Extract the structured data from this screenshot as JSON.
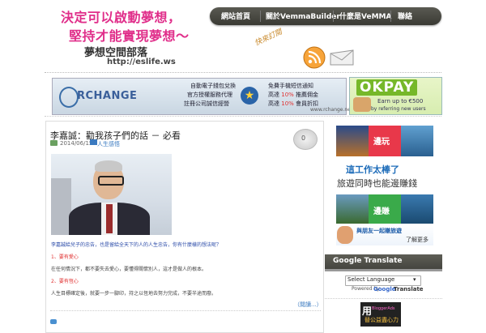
{
  "header": {
    "slogan_line1": "決定可以啟動夢想，",
    "slogan_line2": "堅持才能實現夢想～",
    "site_name": "夢想空間部落",
    "site_url": "http://eslife.ws",
    "rss_label": "快來訂閱"
  },
  "nav": {
    "items": [
      "網站首頁",
      "關於VemmaBuilder",
      "什麼是VeMMA",
      "聯絡"
    ]
  },
  "banner_rchange": {
    "logo": "RCHANGE",
    "left_lines": [
      "自動電子錢包兌換",
      "官方授權服務代理",
      "註冊公司誠信經營"
    ],
    "right_lines": [
      "免費手機短信通知",
      "高達 10% 推薦佣金",
      "高達 10% 會員折扣"
    ],
    "highlight": "10%",
    "site": "www.rchange.net"
  },
  "banner_okpay": {
    "logo": "OKPAY",
    "line1": "Earn up to €500",
    "line2": "by referring new users"
  },
  "post": {
    "title": "李嘉誠：勸我孩子們的話 － 必看",
    "date": "2014/06/15",
    "category": "人生感悟",
    "comments": "0",
    "para1": "李嘉誠給兒子的忠告，也是留給全天下的人的人生忠告，你有什麼樣的想法呢？",
    "item1": "1、要有愛心",
    "para3": "在任何情況下，都不要失去愛心，要懂得關懷別人，這才是做人的根本。",
    "item2": "2、要有恆心",
    "para5": "人生目標確定後，就要一步一腳印，持之以恆地去努力完成，不要半途而廢。",
    "read_more": "（閱讀...）"
  },
  "sidebar": {
    "ad": {
      "btn_play": "邊玩",
      "headline1": "這工作太棒了",
      "headline2": "旅遊同時也能邊賺錢",
      "btn_earn": "邊賺",
      "footer1": "與朋友一起賺旅遊",
      "footer2": "了解更多"
    },
    "google_translate": {
      "title": "Google Translate",
      "select_value": "Select Language",
      "powered_by": "Powered by",
      "google": "Google",
      "translate": "Translate"
    },
    "bottom_ad": {
      "char": "用",
      "brand": "BloggerAds",
      "tagline": "替公益盡心力"
    }
  },
  "colors": {
    "slogan": "#e02e8a",
    "nav_bg": "#45453f",
    "link": "#3a7ac0",
    "accent_red": "#e03030"
  }
}
